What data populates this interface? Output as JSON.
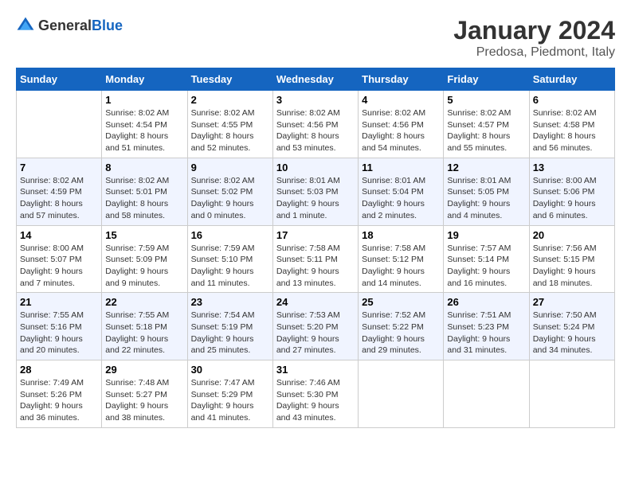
{
  "header": {
    "logo_general": "General",
    "logo_blue": "Blue",
    "title": "January 2024",
    "subtitle": "Predosa, Piedmont, Italy"
  },
  "weekdays": [
    "Sunday",
    "Monday",
    "Tuesday",
    "Wednesday",
    "Thursday",
    "Friday",
    "Saturday"
  ],
  "weeks": [
    [
      {
        "date": "",
        "sunrise": "",
        "sunset": "",
        "daylight": ""
      },
      {
        "date": "1",
        "sunrise": "Sunrise: 8:02 AM",
        "sunset": "Sunset: 4:54 PM",
        "daylight": "Daylight: 8 hours and 51 minutes."
      },
      {
        "date": "2",
        "sunrise": "Sunrise: 8:02 AM",
        "sunset": "Sunset: 4:55 PM",
        "daylight": "Daylight: 8 hours and 52 minutes."
      },
      {
        "date": "3",
        "sunrise": "Sunrise: 8:02 AM",
        "sunset": "Sunset: 4:56 PM",
        "daylight": "Daylight: 8 hours and 53 minutes."
      },
      {
        "date": "4",
        "sunrise": "Sunrise: 8:02 AM",
        "sunset": "Sunset: 4:56 PM",
        "daylight": "Daylight: 8 hours and 54 minutes."
      },
      {
        "date": "5",
        "sunrise": "Sunrise: 8:02 AM",
        "sunset": "Sunset: 4:57 PM",
        "daylight": "Daylight: 8 hours and 55 minutes."
      },
      {
        "date": "6",
        "sunrise": "Sunrise: 8:02 AM",
        "sunset": "Sunset: 4:58 PM",
        "daylight": "Daylight: 8 hours and 56 minutes."
      }
    ],
    [
      {
        "date": "7",
        "sunrise": "Sunrise: 8:02 AM",
        "sunset": "Sunset: 4:59 PM",
        "daylight": "Daylight: 8 hours and 57 minutes."
      },
      {
        "date": "8",
        "sunrise": "Sunrise: 8:02 AM",
        "sunset": "Sunset: 5:01 PM",
        "daylight": "Daylight: 8 hours and 58 minutes."
      },
      {
        "date": "9",
        "sunrise": "Sunrise: 8:02 AM",
        "sunset": "Sunset: 5:02 PM",
        "daylight": "Daylight: 9 hours and 0 minutes."
      },
      {
        "date": "10",
        "sunrise": "Sunrise: 8:01 AM",
        "sunset": "Sunset: 5:03 PM",
        "daylight": "Daylight: 9 hours and 1 minute."
      },
      {
        "date": "11",
        "sunrise": "Sunrise: 8:01 AM",
        "sunset": "Sunset: 5:04 PM",
        "daylight": "Daylight: 9 hours and 2 minutes."
      },
      {
        "date": "12",
        "sunrise": "Sunrise: 8:01 AM",
        "sunset": "Sunset: 5:05 PM",
        "daylight": "Daylight: 9 hours and 4 minutes."
      },
      {
        "date": "13",
        "sunrise": "Sunrise: 8:00 AM",
        "sunset": "Sunset: 5:06 PM",
        "daylight": "Daylight: 9 hours and 6 minutes."
      }
    ],
    [
      {
        "date": "14",
        "sunrise": "Sunrise: 8:00 AM",
        "sunset": "Sunset: 5:07 PM",
        "daylight": "Daylight: 9 hours and 7 minutes."
      },
      {
        "date": "15",
        "sunrise": "Sunrise: 7:59 AM",
        "sunset": "Sunset: 5:09 PM",
        "daylight": "Daylight: 9 hours and 9 minutes."
      },
      {
        "date": "16",
        "sunrise": "Sunrise: 7:59 AM",
        "sunset": "Sunset: 5:10 PM",
        "daylight": "Daylight: 9 hours and 11 minutes."
      },
      {
        "date": "17",
        "sunrise": "Sunrise: 7:58 AM",
        "sunset": "Sunset: 5:11 PM",
        "daylight": "Daylight: 9 hours and 13 minutes."
      },
      {
        "date": "18",
        "sunrise": "Sunrise: 7:58 AM",
        "sunset": "Sunset: 5:12 PM",
        "daylight": "Daylight: 9 hours and 14 minutes."
      },
      {
        "date": "19",
        "sunrise": "Sunrise: 7:57 AM",
        "sunset": "Sunset: 5:14 PM",
        "daylight": "Daylight: 9 hours and 16 minutes."
      },
      {
        "date": "20",
        "sunrise": "Sunrise: 7:56 AM",
        "sunset": "Sunset: 5:15 PM",
        "daylight": "Daylight: 9 hours and 18 minutes."
      }
    ],
    [
      {
        "date": "21",
        "sunrise": "Sunrise: 7:55 AM",
        "sunset": "Sunset: 5:16 PM",
        "daylight": "Daylight: 9 hours and 20 minutes."
      },
      {
        "date": "22",
        "sunrise": "Sunrise: 7:55 AM",
        "sunset": "Sunset: 5:18 PM",
        "daylight": "Daylight: 9 hours and 22 minutes."
      },
      {
        "date": "23",
        "sunrise": "Sunrise: 7:54 AM",
        "sunset": "Sunset: 5:19 PM",
        "daylight": "Daylight: 9 hours and 25 minutes."
      },
      {
        "date": "24",
        "sunrise": "Sunrise: 7:53 AM",
        "sunset": "Sunset: 5:20 PM",
        "daylight": "Daylight: 9 hours and 27 minutes."
      },
      {
        "date": "25",
        "sunrise": "Sunrise: 7:52 AM",
        "sunset": "Sunset: 5:22 PM",
        "daylight": "Daylight: 9 hours and 29 minutes."
      },
      {
        "date": "26",
        "sunrise": "Sunrise: 7:51 AM",
        "sunset": "Sunset: 5:23 PM",
        "daylight": "Daylight: 9 hours and 31 minutes."
      },
      {
        "date": "27",
        "sunrise": "Sunrise: 7:50 AM",
        "sunset": "Sunset: 5:24 PM",
        "daylight": "Daylight: 9 hours and 34 minutes."
      }
    ],
    [
      {
        "date": "28",
        "sunrise": "Sunrise: 7:49 AM",
        "sunset": "Sunset: 5:26 PM",
        "daylight": "Daylight: 9 hours and 36 minutes."
      },
      {
        "date": "29",
        "sunrise": "Sunrise: 7:48 AM",
        "sunset": "Sunset: 5:27 PM",
        "daylight": "Daylight: 9 hours and 38 minutes."
      },
      {
        "date": "30",
        "sunrise": "Sunrise: 7:47 AM",
        "sunset": "Sunset: 5:29 PM",
        "daylight": "Daylight: 9 hours and 41 minutes."
      },
      {
        "date": "31",
        "sunrise": "Sunrise: 7:46 AM",
        "sunset": "Sunset: 5:30 PM",
        "daylight": "Daylight: 9 hours and 43 minutes."
      },
      {
        "date": "",
        "sunrise": "",
        "sunset": "",
        "daylight": ""
      },
      {
        "date": "",
        "sunrise": "",
        "sunset": "",
        "daylight": ""
      },
      {
        "date": "",
        "sunrise": "",
        "sunset": "",
        "daylight": ""
      }
    ]
  ]
}
